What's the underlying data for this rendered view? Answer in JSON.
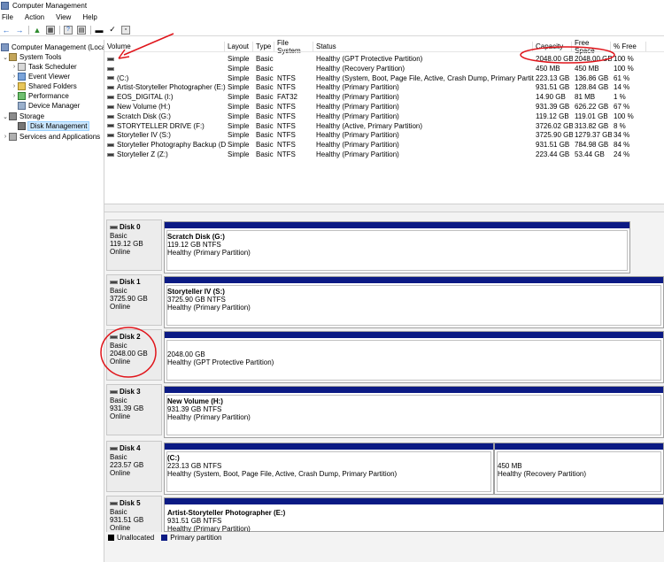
{
  "window": {
    "title": "Computer Management"
  },
  "menu": [
    "File",
    "Action",
    "View",
    "Help"
  ],
  "toolbar": {
    "icons": [
      "back-arrow-icon",
      "forward-arrow-icon",
      "up-folder-icon",
      "show-hide-tree-icon",
      "help-icon",
      "properties-icon",
      "disk-icon",
      "checklist-icon",
      "console-icon"
    ]
  },
  "tree": {
    "root": "Computer Management (Local",
    "system_tools": "System Tools",
    "task_scheduler": "Task Scheduler",
    "event_viewer": "Event Viewer",
    "shared_folders": "Shared Folders",
    "performance": "Performance",
    "device_manager": "Device Manager",
    "storage": "Storage",
    "disk_management": "Disk Management",
    "services": "Services and Applications"
  },
  "volumes": {
    "headers": [
      "Volume",
      "Layout",
      "Type",
      "File System",
      "Status",
      "Capacity",
      "Free Space",
      "% Free"
    ],
    "rows": [
      [
        "",
        "Simple",
        "Basic",
        "",
        "Healthy (GPT Protective Partition)",
        "2048.00 GB",
        "2048.00 GB",
        "100 %"
      ],
      [
        "",
        "Simple",
        "Basic",
        "",
        "Healthy (Recovery Partition)",
        "450 MB",
        "450 MB",
        "100 %"
      ],
      [
        "(C:)",
        "Simple",
        "Basic",
        "NTFS",
        "Healthy (System, Boot, Page File, Active, Crash Dump, Primary Partition)",
        "223.13 GB",
        "136.86 GB",
        "61 %"
      ],
      [
        "Artist-Storyteller Photographer (E:)",
        "Simple",
        "Basic",
        "NTFS",
        "Healthy (Primary Partition)",
        "931.51 GB",
        "128.84 GB",
        "14 %"
      ],
      [
        "EOS_DIGITAL (I:)",
        "Simple",
        "Basic",
        "FAT32",
        "Healthy (Primary Partition)",
        "14.90 GB",
        "81 MB",
        "1 %"
      ],
      [
        "New Volume (H:)",
        "Simple",
        "Basic",
        "NTFS",
        "Healthy (Primary Partition)",
        "931.39 GB",
        "626.22 GB",
        "67 %"
      ],
      [
        "Scratch Disk (G:)",
        "Simple",
        "Basic",
        "NTFS",
        "Healthy (Primary Partition)",
        "119.12 GB",
        "119.01 GB",
        "100 %"
      ],
      [
        "STORYTELLER DRIVE  (F:)",
        "Simple",
        "Basic",
        "NTFS",
        "Healthy (Active, Primary Partition)",
        "3726.02 GB",
        "313.82 GB",
        "8 %"
      ],
      [
        "Storyteller IV (S:)",
        "Simple",
        "Basic",
        "NTFS",
        "Healthy (Primary Partition)",
        "3725.90 GB",
        "1279.37 GB",
        "34 %"
      ],
      [
        "Storyteller Photography Backup (D:)",
        "Simple",
        "Basic",
        "NTFS",
        "Healthy (Primary Partition)",
        "931.51 GB",
        "784.98 GB",
        "84 %"
      ],
      [
        "Storyteller Z (Z:)",
        "Simple",
        "Basic",
        "NTFS",
        "Healthy (Primary Partition)",
        "223.44 GB",
        "53.44 GB",
        "24 %"
      ]
    ]
  },
  "disks": [
    {
      "name": "Disk 0",
      "type": "Basic",
      "size": "119.12 GB",
      "state": "Online",
      "partitions": [
        {
          "name": "Scratch Disk  (G:)",
          "size": "119.12 GB NTFS",
          "status": "Healthy (Primary Partition)"
        }
      ]
    },
    {
      "name": "Disk 1",
      "type": "Basic",
      "size": "3725.90 GB",
      "state": "Online",
      "partitions": [
        {
          "name": "Storyteller IV  (S:)",
          "size": "3725.90 GB NTFS",
          "status": "Healthy (Primary Partition)"
        }
      ]
    },
    {
      "name": "Disk 2",
      "type": "Basic",
      "size": "2048.00 GB",
      "state": "Online",
      "partitions": [
        {
          "name": "",
          "size": "2048.00 GB",
          "status": "Healthy (GPT Protective Partition)"
        }
      ]
    },
    {
      "name": "Disk 3",
      "type": "Basic",
      "size": "931.39 GB",
      "state": "Online",
      "partitions": [
        {
          "name": "New Volume  (H:)",
          "size": "931.39 GB NTFS",
          "status": "Healthy (Primary Partition)"
        }
      ]
    },
    {
      "name": "Disk 4",
      "type": "Basic",
      "size": "223.57 GB",
      "state": "Online",
      "partitions": [
        {
          "name": "(C:)",
          "size": "223.13 GB NTFS",
          "status": "Healthy (System, Boot, Page File, Active, Crash Dump, Primary Partition)"
        },
        {
          "name": "",
          "size": "450 MB",
          "status": "Healthy (Recovery Partition)"
        }
      ]
    },
    {
      "name": "Disk 5",
      "type": "Basic",
      "size": "931.51 GB",
      "state": "Online",
      "partitions": [
        {
          "name": "Artist-Storyteller Photographer  (E:)",
          "size": "931.51 GB NTFS",
          "status": "Healthy (Primary Partition)"
        }
      ]
    }
  ],
  "legend": {
    "unallocated": "Unallocated",
    "primary": "Primary partition"
  },
  "colors": {
    "primary_partition": "#0b1a84",
    "unallocated": "#000000",
    "annotation": "#e0151b",
    "selection": "#cce8ff"
  }
}
